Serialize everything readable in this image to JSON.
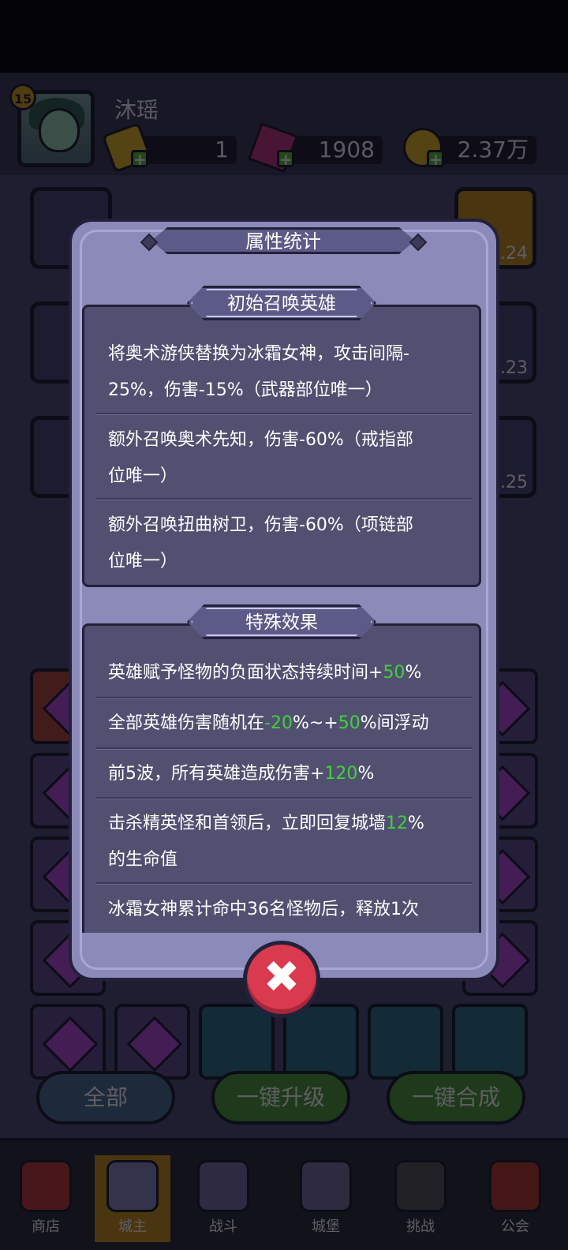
{
  "player": {
    "level": "15",
    "name": "沐瑶",
    "resources": [
      {
        "icon": "gold-bar-icon",
        "value": "1"
      },
      {
        "icon": "pink-crystal-icon",
        "value": "1908"
      },
      {
        "icon": "gold-coin-icon",
        "value": "2.37万"
      }
    ]
  },
  "sidebar": {
    "right_levels": [
      ".24",
      ".23",
      ".25"
    ]
  },
  "action_buttons": {
    "all": "全部",
    "upgrade_all": "一键升级",
    "merge_all": "一键合成"
  },
  "nav": {
    "items": [
      {
        "label": "商店",
        "icon": "shop-icon"
      },
      {
        "label": "城主",
        "icon": "crown-icon"
      },
      {
        "label": "战斗",
        "icon": "swords-icon"
      },
      {
        "label": "城堡",
        "icon": "castle-icon"
      },
      {
        "label": "挑战",
        "icon": "demon-icon"
      },
      {
        "label": "公会",
        "icon": "guild-banner-icon"
      }
    ],
    "selected": "城主"
  },
  "dialog": {
    "title": "属性统计",
    "section1": {
      "heading": "初始召唤英雄",
      "entries": [
        {
          "line1": "将奥术游侠替换为冰霜女神，攻击间隔-",
          "line2": "25%，伤害-15%（武器部位唯一）"
        },
        {
          "line1": "额外召唤奥术先知，伤害-60%（戒指部",
          "line2": "位唯一）"
        },
        {
          "line1": "额外召唤扭曲树卫，伤害-60%（项链部",
          "line2": "位唯一）"
        }
      ]
    },
    "section2": {
      "heading": "特殊效果",
      "e1": {
        "pre": "英雄赋予怪物的负面状态持续时间+",
        "val": "50",
        "post": "%"
      },
      "e2": {
        "pre": "全部英雄伤害随机在",
        "val1": "-20",
        "mid": "%~+",
        "val2": "50",
        "post": "%间浮动"
      },
      "e3": {
        "pre": "前5波，所有英雄造成伤害+",
        "val": "120",
        "post": "%"
      },
      "e4": {
        "pre": "击杀精英怪和首领后，立即回复城墙",
        "val": "12",
        "post": "%",
        "line2": "的生命值"
      },
      "e5": {
        "line1": "冰霜女神累计命中36名怪物后，释放1次"
      }
    },
    "close_icon": "close-icon",
    "accent_green": "#3fd13d",
    "close_color": "#d93a4e"
  }
}
